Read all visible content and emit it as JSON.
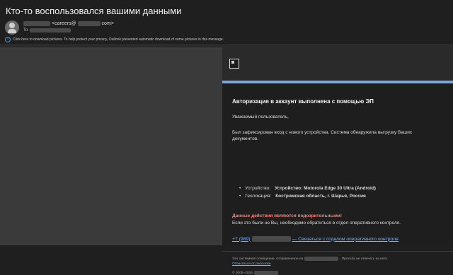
{
  "header": {
    "subject": "Кто-то воспользовался вашими данными",
    "from_prefix": "<careers@",
    "from_suffix": "com>",
    "to_label": "To",
    "download_notice": "Click here to download pictures. To help protect your privacy, Outlook prevented automatic download of some pictures in this message."
  },
  "email": {
    "title": "Авторизация в аккаунт выполнена с помощью ЭП",
    "greeting": "Уважаемый пользователь,",
    "paragraph": "Был зафиксирован вход с нового устройства. Система обнаружила выгрузку Ваших документов.",
    "device_label": "Устройство:",
    "device_value": "Устройство: Motorola Edge 30 Ultra (Android)",
    "geo_label": "Геолокация:",
    "geo_value": "Костромская область, г. Шарья, Россия",
    "warning": "Данные действия являются подозрительными!",
    "contact_text": "Если это были не Вы, необходимо обратиться в отдел оперативного контроля.",
    "phone_prefix": "+7 (989)",
    "link_text": "— Связаться с отделом оперативного контроля"
  },
  "footer": {
    "system_message_prefix": "Это системное сообщение, отправленное на",
    "system_message_suffix": ". Просьба не отвечать на него.",
    "unsubscribe": "Отписаться от рассылки",
    "copyright_prefix": "© 2005–2026"
  },
  "colors": {
    "accent_blue": "#7da6d9",
    "warning_red": "#ff7d73",
    "link_blue": "#77b5ff"
  }
}
